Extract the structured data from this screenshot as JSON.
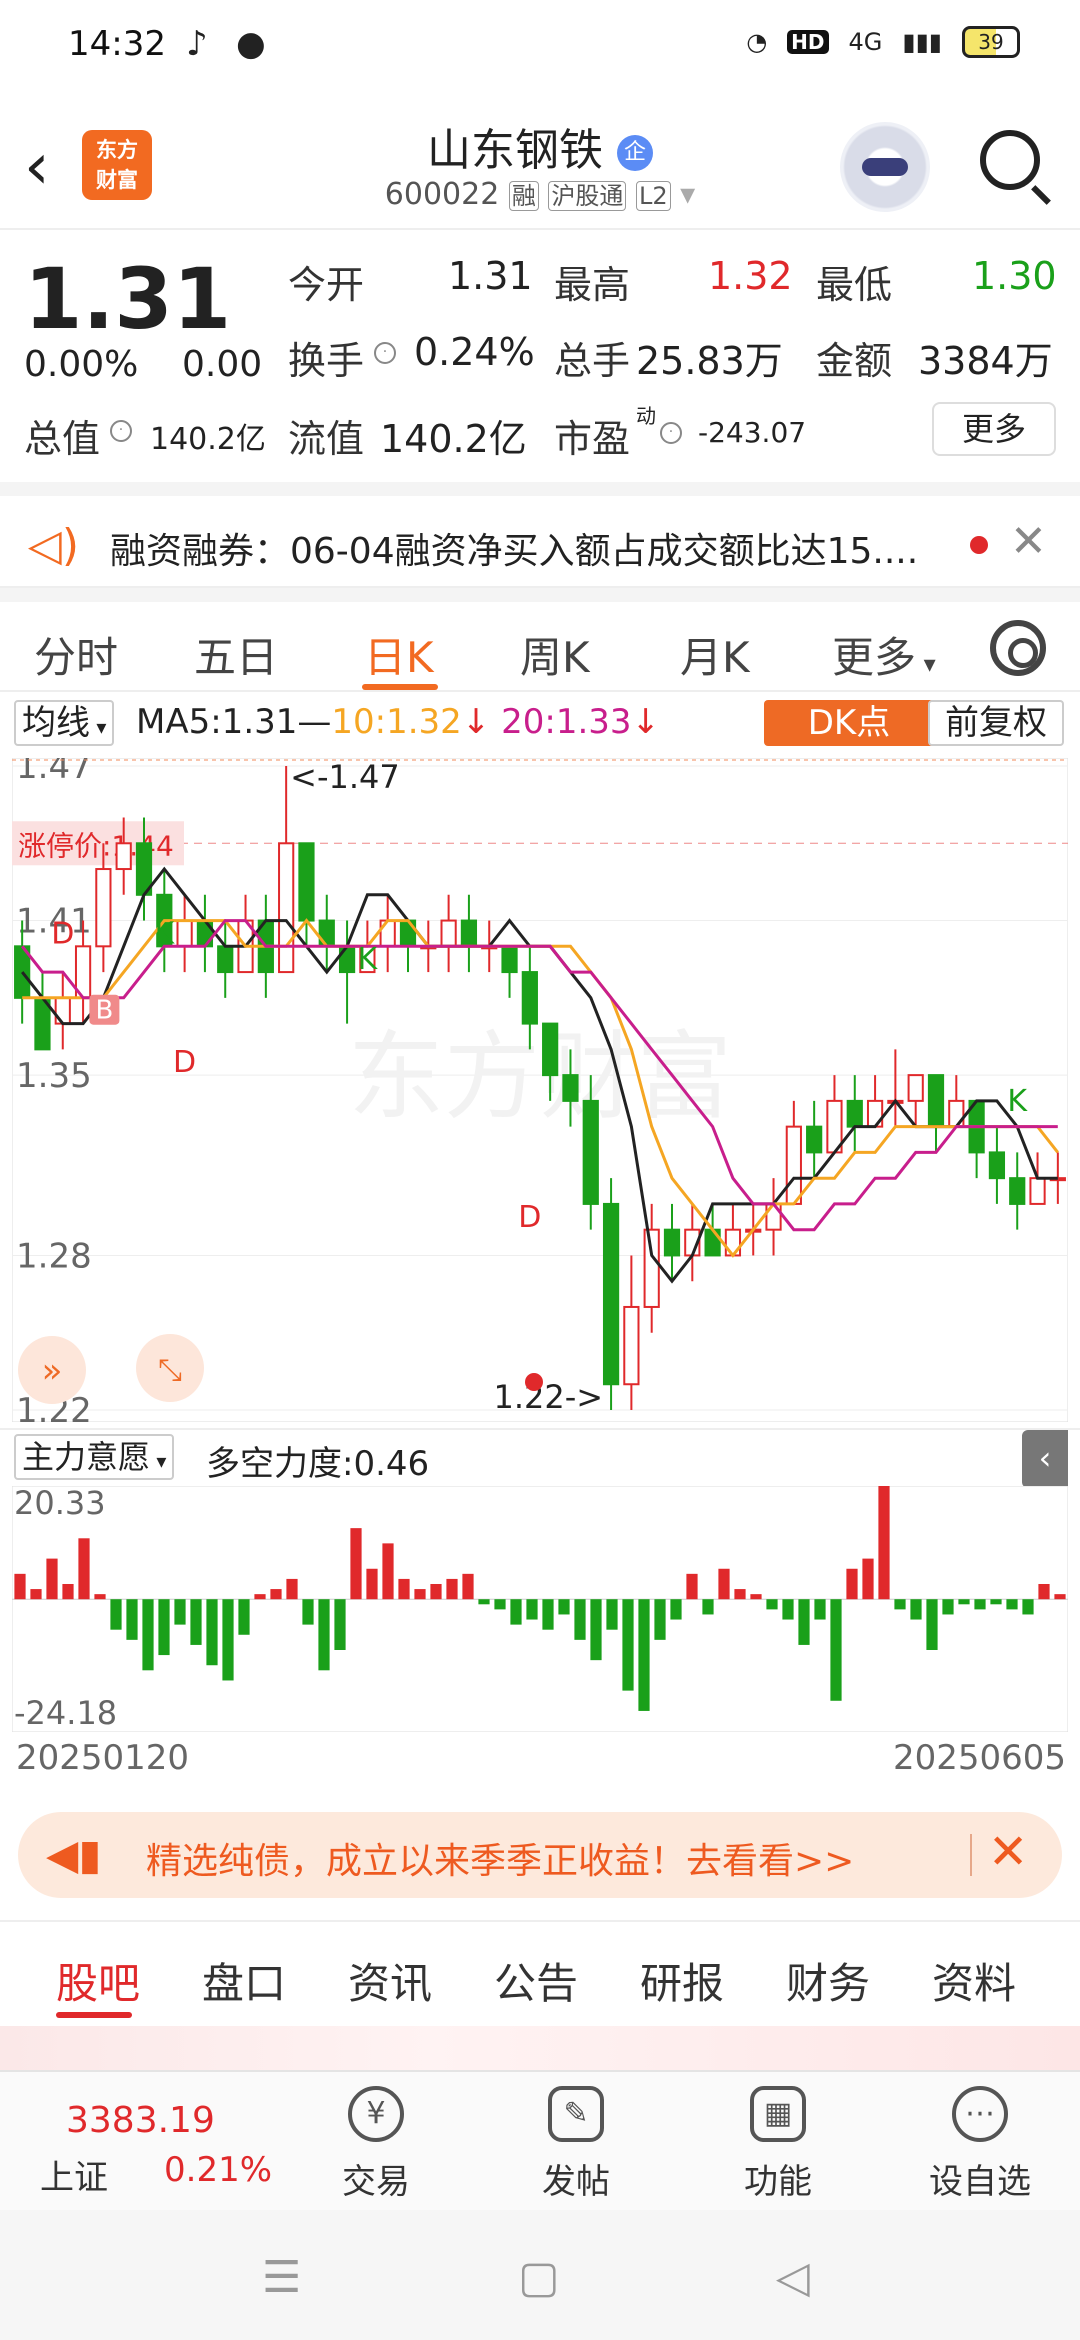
{
  "status_bar": {
    "time": "14:32",
    "network": "4G",
    "hd": "HD",
    "battery": "39"
  },
  "header": {
    "brand_line1": "东方",
    "brand_line2": "财富",
    "stock_name": "山东钢铁",
    "badge": "企",
    "code": "600022",
    "tags": [
      "融",
      "沪股通",
      "L2"
    ]
  },
  "quote": {
    "price": "1.31",
    "change_pct": "0.00%",
    "change": "0.00",
    "open_label": "今开",
    "open": "1.31",
    "high_label": "最高",
    "high": "1.32",
    "low_label": "最低",
    "low": "1.30",
    "turnover_label": "换手",
    "turnover": "0.24%",
    "volume_label": "总手",
    "volume": "25.83万",
    "amount_label": "金额",
    "amount": "3384万",
    "mktcap_label": "总值",
    "mktcap": "140.2亿",
    "float_label": "流值",
    "float": "140.2亿",
    "pe_label": "市盈",
    "pe_sup": "动",
    "pe": "-243.07",
    "more": "更多"
  },
  "notice": {
    "text": "融资融券：06-04融资净买入额占成交额比达15...."
  },
  "tabs": {
    "items": [
      "分时",
      "五日",
      "日K",
      "周K",
      "月K",
      "更多"
    ],
    "active": 2
  },
  "ma_row": {
    "selector": "均线",
    "ma5": "MA5:1.31",
    "ma10": "10:1.32",
    "ma20": "20:1.33",
    "dk": "DK点",
    "adjust": "前复权"
  },
  "colors": {
    "up": "#e0292b",
    "down": "#1aa01a",
    "ma5": "#222222",
    "ma10": "#f5a623",
    "ma20": "#c81e8c",
    "accent": "#f26a21"
  },
  "chart_data": {
    "type": "candlestick",
    "y_ticks": [
      "1.47",
      "1.41",
      "1.35",
      "1.28",
      "1.22"
    ],
    "y_range": [
      1.22,
      1.47
    ],
    "limit_label": "涨停价:1.44",
    "limit_value": 1.44,
    "max_label": "<-1.47",
    "min_label": "1.22->",
    "markers": [
      "D",
      "B",
      "K",
      "D",
      "K",
      "D",
      "K"
    ],
    "watermark": "东方财富",
    "x_start": "20250120",
    "x_end": "20250605",
    "ma5": [
      1.39,
      1.38,
      1.37,
      1.37,
      1.38,
      1.4,
      1.42,
      1.43,
      1.42,
      1.41,
      1.4,
      1.4,
      1.41,
      1.41,
      1.4,
      1.39,
      1.4,
      1.42,
      1.42,
      1.41,
      1.4,
      1.4,
      1.4,
      1.4,
      1.41,
      1.4,
      1.4,
      1.39,
      1.38,
      1.36,
      1.33,
      1.28,
      1.27,
      1.28,
      1.3,
      1.3,
      1.3,
      1.3,
      1.31,
      1.31,
      1.32,
      1.33,
      1.33,
      1.34,
      1.33,
      1.33,
      1.33,
      1.34,
      1.34,
      1.33,
      1.31,
      1.31
    ],
    "ma10": [
      1.38,
      1.38,
      1.38,
      1.38,
      1.38,
      1.39,
      1.4,
      1.41,
      1.41,
      1.41,
      1.41,
      1.4,
      1.4,
      1.4,
      1.41,
      1.4,
      1.4,
      1.4,
      1.41,
      1.41,
      1.4,
      1.4,
      1.4,
      1.4,
      1.4,
      1.4,
      1.4,
      1.4,
      1.39,
      1.38,
      1.36,
      1.33,
      1.31,
      1.3,
      1.29,
      1.28,
      1.29,
      1.3,
      1.3,
      1.31,
      1.31,
      1.32,
      1.32,
      1.33,
      1.33,
      1.33,
      1.33,
      1.33,
      1.33,
      1.33,
      1.33,
      1.32
    ],
    "ma20": [
      1.4,
      1.39,
      1.39,
      1.38,
      1.38,
      1.38,
      1.39,
      1.4,
      1.4,
      1.4,
      1.41,
      1.41,
      1.4,
      1.4,
      1.4,
      1.4,
      1.4,
      1.4,
      1.4,
      1.4,
      1.4,
      1.4,
      1.4,
      1.4,
      1.4,
      1.4,
      1.4,
      1.39,
      1.39,
      1.38,
      1.37,
      1.36,
      1.35,
      1.34,
      1.33,
      1.31,
      1.3,
      1.3,
      1.29,
      1.29,
      1.3,
      1.3,
      1.31,
      1.31,
      1.32,
      1.32,
      1.33,
      1.33,
      1.33,
      1.33,
      1.33,
      1.33
    ],
    "candles": [
      [
        1.4,
        1.38,
        1.41,
        1.37
      ],
      [
        1.38,
        1.36,
        1.39,
        1.36
      ],
      [
        1.37,
        1.38,
        1.39,
        1.36
      ],
      [
        1.38,
        1.4,
        1.41,
        1.37
      ],
      [
        1.4,
        1.43,
        1.44,
        1.39
      ],
      [
        1.43,
        1.44,
        1.45,
        1.42
      ],
      [
        1.44,
        1.42,
        1.45,
        1.41
      ],
      [
        1.42,
        1.4,
        1.43,
        1.39
      ],
      [
        1.4,
        1.41,
        1.42,
        1.39
      ],
      [
        1.41,
        1.4,
        1.42,
        1.39
      ],
      [
        1.4,
        1.39,
        1.41,
        1.38
      ],
      [
        1.39,
        1.41,
        1.42,
        1.39
      ],
      [
        1.41,
        1.39,
        1.42,
        1.38
      ],
      [
        1.39,
        1.44,
        1.47,
        1.39
      ],
      [
        1.44,
        1.41,
        1.44,
        1.4
      ],
      [
        1.41,
        1.4,
        1.42,
        1.39
      ],
      [
        1.4,
        1.39,
        1.41,
        1.37
      ],
      [
        1.39,
        1.4,
        1.41,
        1.39
      ],
      [
        1.4,
        1.41,
        1.42,
        1.39
      ],
      [
        1.41,
        1.4,
        1.41,
        1.39
      ],
      [
        1.4,
        1.4,
        1.41,
        1.39
      ],
      [
        1.4,
        1.41,
        1.42,
        1.39
      ],
      [
        1.41,
        1.4,
        1.42,
        1.39
      ],
      [
        1.4,
        1.4,
        1.41,
        1.39
      ],
      [
        1.4,
        1.39,
        1.4,
        1.38
      ],
      [
        1.39,
        1.37,
        1.4,
        1.36
      ],
      [
        1.37,
        1.35,
        1.37,
        1.34
      ],
      [
        1.35,
        1.34,
        1.36,
        1.33
      ],
      [
        1.34,
        1.3,
        1.35,
        1.29
      ],
      [
        1.3,
        1.23,
        1.31,
        1.22
      ],
      [
        1.23,
        1.26,
        1.28,
        1.22
      ],
      [
        1.26,
        1.29,
        1.3,
        1.25
      ],
      [
        1.29,
        1.28,
        1.3,
        1.27
      ],
      [
        1.28,
        1.29,
        1.3,
        1.27
      ],
      [
        1.29,
        1.28,
        1.3,
        1.28
      ],
      [
        1.28,
        1.29,
        1.3,
        1.28
      ],
      [
        1.29,
        1.29,
        1.3,
        1.28
      ],
      [
        1.29,
        1.3,
        1.31,
        1.28
      ],
      [
        1.3,
        1.33,
        1.34,
        1.3
      ],
      [
        1.33,
        1.32,
        1.34,
        1.31
      ],
      [
        1.32,
        1.34,
        1.35,
        1.32
      ],
      [
        1.34,
        1.33,
        1.35,
        1.32
      ],
      [
        1.33,
        1.34,
        1.35,
        1.33
      ],
      [
        1.34,
        1.34,
        1.36,
        1.33
      ],
      [
        1.34,
        1.35,
        1.35,
        1.33
      ],
      [
        1.35,
        1.33,
        1.35,
        1.32
      ],
      [
        1.33,
        1.34,
        1.35,
        1.33
      ],
      [
        1.34,
        1.32,
        1.34,
        1.31
      ],
      [
        1.32,
        1.31,
        1.33,
        1.3
      ],
      [
        1.31,
        1.3,
        1.32,
        1.29
      ],
      [
        1.3,
        1.31,
        1.32,
        1.3
      ],
      [
        1.31,
        1.31,
        1.32,
        1.3
      ]
    ]
  },
  "indicator": {
    "selector": "主力意愿",
    "label": "多空力度:0.46",
    "max": "20.33",
    "min": "-24.18",
    "range": [
      -24.18,
      20.33
    ],
    "values": [
      5,
      2,
      8,
      3,
      12,
      1,
      -6,
      -8,
      -14,
      -11,
      -5,
      -9,
      -13,
      -16,
      -7,
      1,
      2,
      4,
      -5,
      -14,
      -10,
      14,
      6,
      11,
      4,
      2,
      3,
      4,
      5,
      -1,
      -2,
      -5,
      -4,
      -6,
      -3,
      -8,
      -12,
      -6,
      -18,
      -22,
      -8,
      -4,
      5,
      -3,
      6,
      2,
      1,
      -2,
      -4,
      -9,
      -4,
      -20,
      6,
      8,
      24,
      -2,
      -4,
      -10,
      -3,
      -1,
      -2,
      -1,
      -2,
      -3,
      3,
      1
    ]
  },
  "ad": {
    "text": "精选纯债，成立以来季季正收益！去看看>>"
  },
  "sections": {
    "items": [
      "股吧",
      "盘口",
      "资讯",
      "公告",
      "研报",
      "财务",
      "资料"
    ],
    "active": 0
  },
  "bottom_bar": {
    "index_value": "3383.19",
    "index_name": "上证",
    "index_pct": "0.21%",
    "items": [
      {
        "label": "交易",
        "icon": "trade-icon",
        "glyph": "¥"
      },
      {
        "label": "发帖",
        "icon": "post-icon",
        "glyph": "✎"
      },
      {
        "label": "功能",
        "icon": "grid-icon",
        "glyph": "▦"
      },
      {
        "label": "设自选",
        "icon": "more-icon",
        "glyph": "⋯"
      }
    ]
  },
  "nav": {
    "menu": "☰",
    "home": "▢",
    "back": "◁"
  }
}
